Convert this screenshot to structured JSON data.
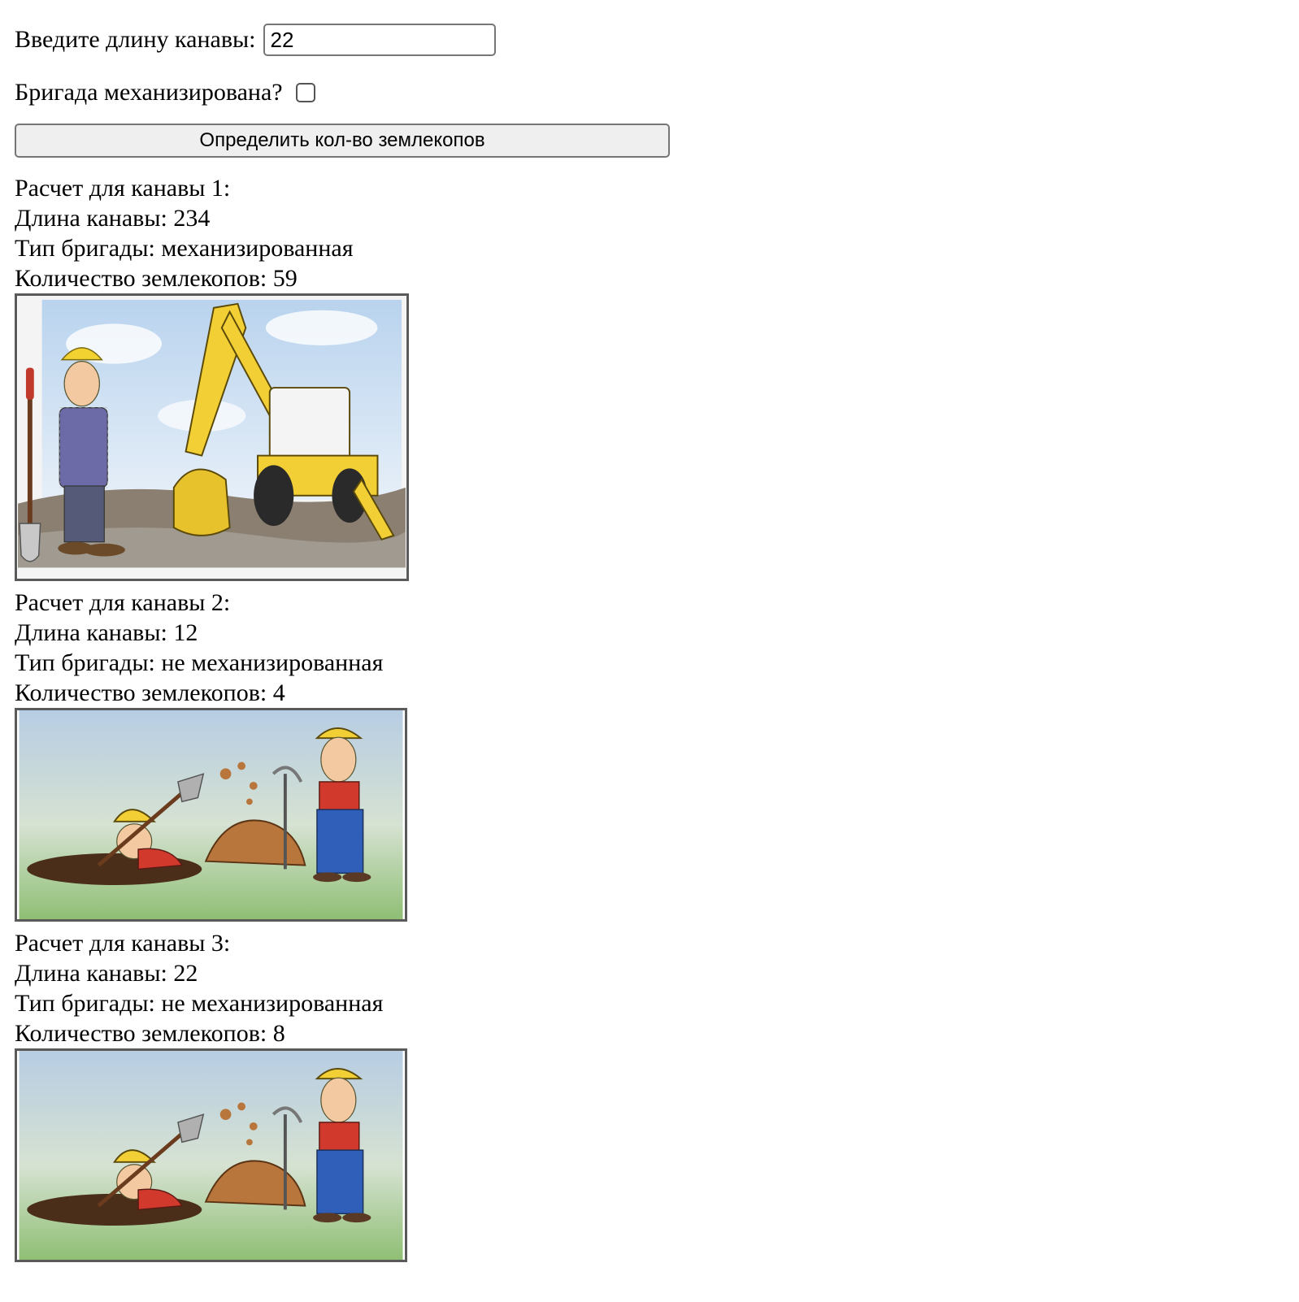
{
  "form": {
    "length_label": "Введите длину канавы:",
    "length_value": "22",
    "mechanized_label": "Бригада механизирована?",
    "mechanized_checked": false,
    "submit_label": "Определить кол-во землекопов"
  },
  "results": [
    {
      "heading": "Расчет для канавы 1:",
      "length_line": "Длина канавы: 234",
      "type_line": "Тип бригады: механизированная",
      "count_line": "Количество землекопов: 59",
      "illustration": "worker-with-excavator"
    },
    {
      "heading": "Расчет для канавы 2:",
      "length_line": "Длина канавы: 12",
      "type_line": "Тип бригады: не механизированная",
      "count_line": "Количество землекопов: 4",
      "illustration": "diggers-with-shovel-and-pickaxe"
    },
    {
      "heading": "Расчет для канавы 3:",
      "length_line": "Длина канавы: 22",
      "type_line": "Тип бригады: не механизированная",
      "count_line": "Количество землекопов: 8",
      "illustration": "diggers-with-shovel-and-pickaxe"
    }
  ]
}
